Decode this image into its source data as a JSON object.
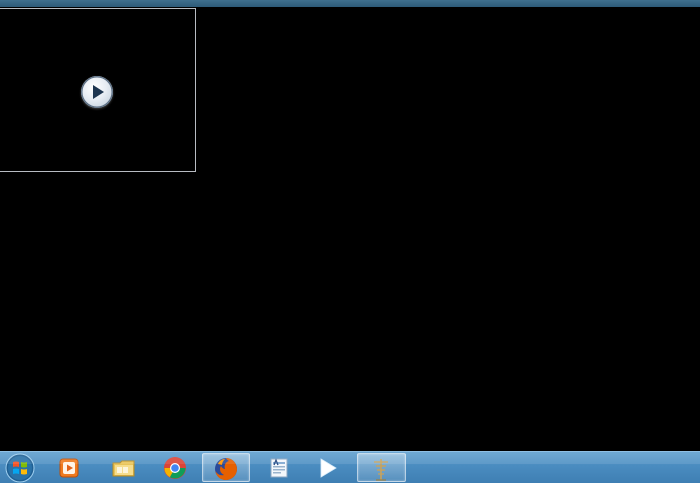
{
  "colors": {
    "desktop_background": "#000000",
    "top_strip": "#3f6f8e",
    "taskbar": "#4a8cc0",
    "frame_border": "#b8bcc2"
  },
  "video_preview": {
    "icon": "play-circle-icon"
  },
  "taskbar": {
    "start_icon": "windows-logo-icon",
    "items": [
      {
        "icon": "media-player-icon",
        "active": false
      },
      {
        "icon": "file-explorer-icon",
        "active": false
      },
      {
        "icon": "chrome-icon",
        "active": false
      },
      {
        "icon": "firefox-icon",
        "active": true
      },
      {
        "icon": "document-app-icon",
        "active": false
      },
      {
        "icon": "play-arrow-icon",
        "active": false
      },
      {
        "icon": "antenna-app-icon",
        "active": true
      }
    ]
  }
}
